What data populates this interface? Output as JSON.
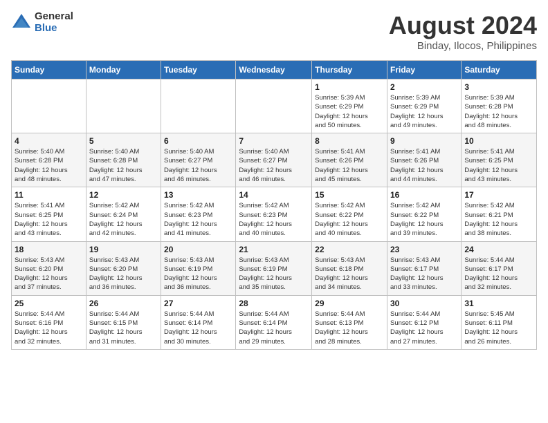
{
  "header": {
    "logo_general": "General",
    "logo_blue": "Blue",
    "month": "August 2024",
    "location": "Binday, Ilocos, Philippines"
  },
  "days_of_week": [
    "Sunday",
    "Monday",
    "Tuesday",
    "Wednesday",
    "Thursday",
    "Friday",
    "Saturday"
  ],
  "weeks": [
    [
      {
        "day": "",
        "info": ""
      },
      {
        "day": "",
        "info": ""
      },
      {
        "day": "",
        "info": ""
      },
      {
        "day": "",
        "info": ""
      },
      {
        "day": "1",
        "info": "Sunrise: 5:39 AM\nSunset: 6:29 PM\nDaylight: 12 hours\nand 50 minutes."
      },
      {
        "day": "2",
        "info": "Sunrise: 5:39 AM\nSunset: 6:29 PM\nDaylight: 12 hours\nand 49 minutes."
      },
      {
        "day": "3",
        "info": "Sunrise: 5:39 AM\nSunset: 6:28 PM\nDaylight: 12 hours\nand 48 minutes."
      }
    ],
    [
      {
        "day": "4",
        "info": "Sunrise: 5:40 AM\nSunset: 6:28 PM\nDaylight: 12 hours\nand 48 minutes."
      },
      {
        "day": "5",
        "info": "Sunrise: 5:40 AM\nSunset: 6:28 PM\nDaylight: 12 hours\nand 47 minutes."
      },
      {
        "day": "6",
        "info": "Sunrise: 5:40 AM\nSunset: 6:27 PM\nDaylight: 12 hours\nand 46 minutes."
      },
      {
        "day": "7",
        "info": "Sunrise: 5:40 AM\nSunset: 6:27 PM\nDaylight: 12 hours\nand 46 minutes."
      },
      {
        "day": "8",
        "info": "Sunrise: 5:41 AM\nSunset: 6:26 PM\nDaylight: 12 hours\nand 45 minutes."
      },
      {
        "day": "9",
        "info": "Sunrise: 5:41 AM\nSunset: 6:26 PM\nDaylight: 12 hours\nand 44 minutes."
      },
      {
        "day": "10",
        "info": "Sunrise: 5:41 AM\nSunset: 6:25 PM\nDaylight: 12 hours\nand 43 minutes."
      }
    ],
    [
      {
        "day": "11",
        "info": "Sunrise: 5:41 AM\nSunset: 6:25 PM\nDaylight: 12 hours\nand 43 minutes."
      },
      {
        "day": "12",
        "info": "Sunrise: 5:42 AM\nSunset: 6:24 PM\nDaylight: 12 hours\nand 42 minutes."
      },
      {
        "day": "13",
        "info": "Sunrise: 5:42 AM\nSunset: 6:23 PM\nDaylight: 12 hours\nand 41 minutes."
      },
      {
        "day": "14",
        "info": "Sunrise: 5:42 AM\nSunset: 6:23 PM\nDaylight: 12 hours\nand 40 minutes."
      },
      {
        "day": "15",
        "info": "Sunrise: 5:42 AM\nSunset: 6:22 PM\nDaylight: 12 hours\nand 40 minutes."
      },
      {
        "day": "16",
        "info": "Sunrise: 5:42 AM\nSunset: 6:22 PM\nDaylight: 12 hours\nand 39 minutes."
      },
      {
        "day": "17",
        "info": "Sunrise: 5:42 AM\nSunset: 6:21 PM\nDaylight: 12 hours\nand 38 minutes."
      }
    ],
    [
      {
        "day": "18",
        "info": "Sunrise: 5:43 AM\nSunset: 6:20 PM\nDaylight: 12 hours\nand 37 minutes."
      },
      {
        "day": "19",
        "info": "Sunrise: 5:43 AM\nSunset: 6:20 PM\nDaylight: 12 hours\nand 36 minutes."
      },
      {
        "day": "20",
        "info": "Sunrise: 5:43 AM\nSunset: 6:19 PM\nDaylight: 12 hours\nand 36 minutes."
      },
      {
        "day": "21",
        "info": "Sunrise: 5:43 AM\nSunset: 6:19 PM\nDaylight: 12 hours\nand 35 minutes."
      },
      {
        "day": "22",
        "info": "Sunrise: 5:43 AM\nSunset: 6:18 PM\nDaylight: 12 hours\nand 34 minutes."
      },
      {
        "day": "23",
        "info": "Sunrise: 5:43 AM\nSunset: 6:17 PM\nDaylight: 12 hours\nand 33 minutes."
      },
      {
        "day": "24",
        "info": "Sunrise: 5:44 AM\nSunset: 6:17 PM\nDaylight: 12 hours\nand 32 minutes."
      }
    ],
    [
      {
        "day": "25",
        "info": "Sunrise: 5:44 AM\nSunset: 6:16 PM\nDaylight: 12 hours\nand 32 minutes."
      },
      {
        "day": "26",
        "info": "Sunrise: 5:44 AM\nSunset: 6:15 PM\nDaylight: 12 hours\nand 31 minutes."
      },
      {
        "day": "27",
        "info": "Sunrise: 5:44 AM\nSunset: 6:14 PM\nDaylight: 12 hours\nand 30 minutes."
      },
      {
        "day": "28",
        "info": "Sunrise: 5:44 AM\nSunset: 6:14 PM\nDaylight: 12 hours\nand 29 minutes."
      },
      {
        "day": "29",
        "info": "Sunrise: 5:44 AM\nSunset: 6:13 PM\nDaylight: 12 hours\nand 28 minutes."
      },
      {
        "day": "30",
        "info": "Sunrise: 5:44 AM\nSunset: 6:12 PM\nDaylight: 12 hours\nand 27 minutes."
      },
      {
        "day": "31",
        "info": "Sunrise: 5:45 AM\nSunset: 6:11 PM\nDaylight: 12 hours\nand 26 minutes."
      }
    ]
  ]
}
